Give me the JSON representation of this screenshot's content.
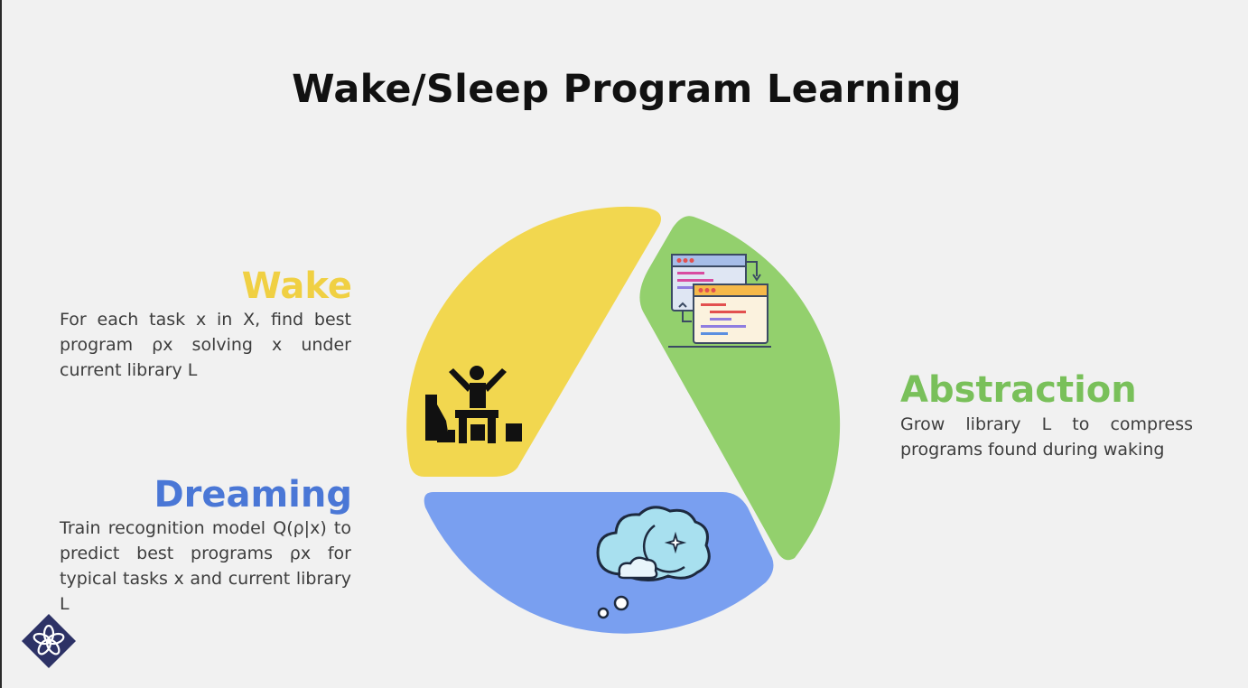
{
  "title": "Wake/Sleep Program Learning",
  "stages": {
    "wake": {
      "title": "Wake",
      "description": "For each task x in X, find best program ρx solving x under current library L",
      "color": "#f2d74f",
      "heading_color": "#f0d043",
      "icon": "person-at-desk-icon"
    },
    "abstraction": {
      "title": "Abstraction",
      "description": "Grow library L to compress programs found during waking",
      "color": "#93d06d",
      "heading_color": "#79c05a",
      "icon": "code-windows-icon"
    },
    "dreaming": {
      "title": "Dreaming",
      "description": "Train recognition model Q(ρ|x) to predict best programs ρx for typical tasks x and current library L",
      "color": "#799ff0",
      "heading_color": "#4a77d6",
      "icon": "dream-cloud-moon-icon"
    }
  },
  "logo": "flower-diamond-logo"
}
